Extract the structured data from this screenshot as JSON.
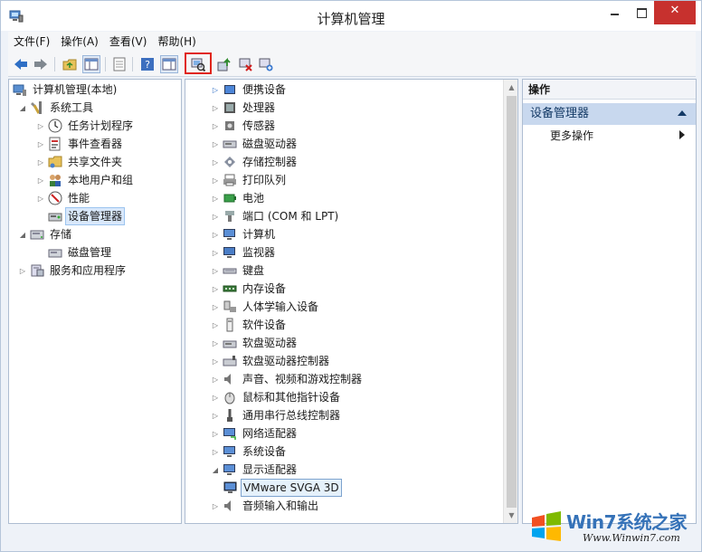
{
  "window": {
    "title": "计算机管理"
  },
  "menubar": {
    "items": [
      "文件(F)",
      "操作(A)",
      "查看(V)",
      "帮助(H)"
    ]
  },
  "left_tree": {
    "root": "计算机管理(本地)",
    "system_tools": "系统工具",
    "task_scheduler": "任务计划程序",
    "event_viewer": "事件查看器",
    "shared_folders": "共享文件夹",
    "local_users": "本地用户和组",
    "performance": "性能",
    "device_manager": "设备管理器",
    "storage": "存储",
    "disk_management": "磁盘管理",
    "services_apps": "服务和应用程序"
  },
  "device_tree": {
    "items": [
      "便携设备",
      "处理器",
      "传感器",
      "磁盘驱动器",
      "存储控制器",
      "打印队列",
      "电池",
      "端口 (COM 和 LPT)",
      "计算机",
      "监视器",
      "键盘",
      "内存设备",
      "人体学输入设备",
      "软件设备",
      "软盘驱动器",
      "软盘驱动器控制器",
      "声音、视频和游戏控制器",
      "鼠标和其他指针设备",
      "通用串行总线控制器",
      "网络适配器",
      "系统设备",
      "显示适配器"
    ],
    "display_child": "VMware SVGA 3D",
    "last_item": "音频输入和输出"
  },
  "actions": {
    "header": "操作",
    "section": "设备管理器",
    "more": "更多操作"
  },
  "watermark": {
    "brand": "Win7系统之家",
    "url": "Www.Winwin7.com"
  }
}
